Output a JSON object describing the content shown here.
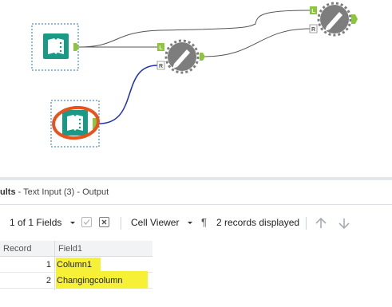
{
  "results_header": {
    "title_fragment": "ults",
    "subtitle": " - Text Input (3) - Output"
  },
  "toolbar": {
    "fields_selector": "1 of 1 Fields",
    "cell_viewer": "Cell Viewer",
    "records_displayed": "2 records displayed"
  },
  "table": {
    "columns": [
      "Record",
      "Field1"
    ],
    "rows": [
      {
        "record": "1",
        "field1": "Column1"
      },
      {
        "record": "2",
        "field1": "Changingcolumn"
      }
    ]
  },
  "connector_labels": {
    "left": "L",
    "right": "R"
  },
  "colors": {
    "text_input_tool": "#1a9a86",
    "join_tool": "#7d7d7d",
    "anchor_green": "#8cc63f",
    "highlight": "#f6f037",
    "circle_annotation": "#e8531d",
    "blue_connection": "#1b2fb3"
  },
  "icons": {
    "fields_dropdown": "chevron-down-icon",
    "check": "checkmark-icon",
    "clear": "x-box-icon",
    "cell_viewer_dropdown": "chevron-down-icon",
    "pilcrow": "pilcrow-icon",
    "up": "arrow-up-icon",
    "down": "arrow-down-icon"
  }
}
